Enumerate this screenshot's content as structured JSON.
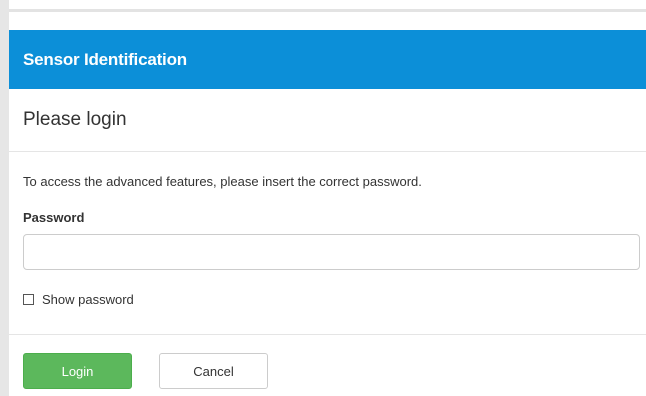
{
  "panel": {
    "title": "Sensor Identification"
  },
  "dialog": {
    "heading": "Please login",
    "intro": "To access the advanced features, please insert the correct password.",
    "password_label": "Password",
    "password_value": "",
    "show_password_label": "Show password",
    "show_password_checked": false
  },
  "buttons": {
    "login": "Login",
    "cancel": "Cancel"
  },
  "colors": {
    "header_bg": "#0c8fd8",
    "login_bg": "#5cb85c"
  }
}
